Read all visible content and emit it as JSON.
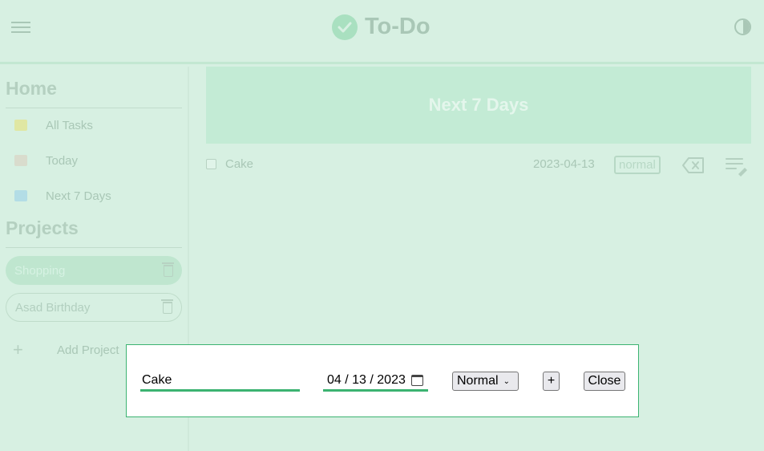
{
  "header": {
    "title": "To-Do",
    "menu_icon": "hamburger-menu-icon",
    "logo_icon": "check-circle-icon",
    "theme_icon": "contrast-toggle-icon"
  },
  "sidebar": {
    "home_title": "Home",
    "nav_items": [
      {
        "label": "All Tasks",
        "icon": "inbox-icon",
        "color": "#e0e7a3"
      },
      {
        "label": "Today",
        "icon": "calendar-day-icon",
        "color": "#d9dccd"
      },
      {
        "label": "Next 7 Days",
        "icon": "calendar-week-icon",
        "color": "#b3dde6"
      }
    ],
    "projects_title": "Projects",
    "projects": [
      {
        "label": "Shopping",
        "active": true
      },
      {
        "label": "Asad Birthday",
        "active": false
      }
    ],
    "add_project_label": "Add Project"
  },
  "main": {
    "banner_title": "Next 7 Days",
    "tasks": [
      {
        "name": "Cake",
        "date": "2023-04-13",
        "priority": "normal",
        "done": false
      }
    ]
  },
  "modal": {
    "task_value": "Cake",
    "date_display": "04 / 13 / 2023",
    "priority_selected": "Normal",
    "add_label": "+",
    "close_label": "Close"
  },
  "colors": {
    "accent": "#3cb371",
    "background": "#d7f0e2",
    "banner": "#c3ebd5"
  }
}
